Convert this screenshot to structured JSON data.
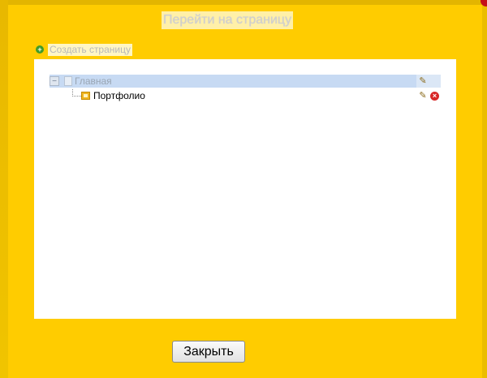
{
  "dialog": {
    "title": "Перейти на страницу"
  },
  "create_page": {
    "label": "Создать страницу",
    "icon": "plus-circle-icon"
  },
  "tree": {
    "root": {
      "label": "Главная",
      "collapse_symbol": "−",
      "edit_icon": "✎"
    },
    "child": {
      "label": "Портфолио",
      "edit_icon": "✎",
      "delete_icon": "×"
    }
  },
  "footer": {
    "close_label": "Закрыть"
  },
  "colors": {
    "dialog_background": "#ffcc00",
    "selected_row": "#c7daf3",
    "delete": "#d82828",
    "add": "#3f9b2a"
  }
}
